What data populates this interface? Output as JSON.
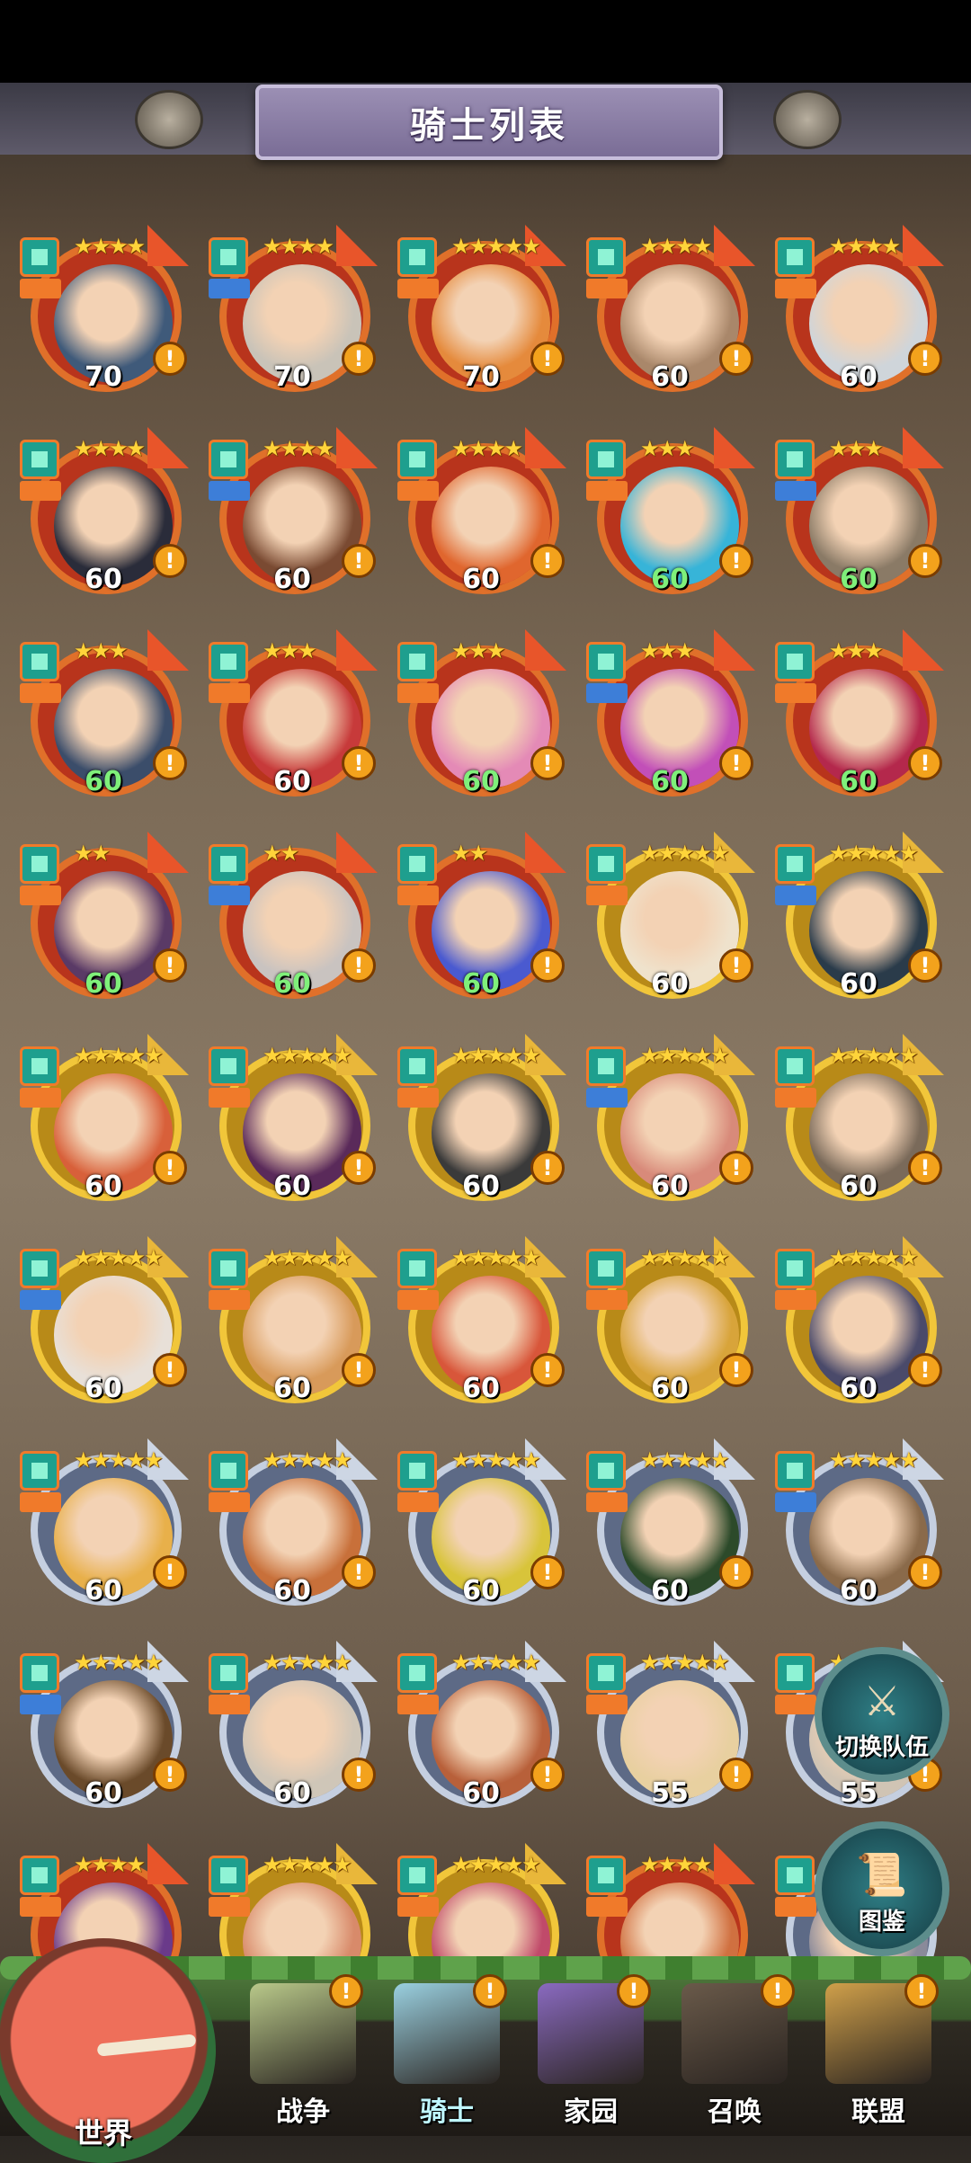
{
  "header": {
    "title": "骑士列表"
  },
  "knights": [
    {
      "level": "70",
      "stars": "★★★★",
      "frame": "red",
      "role": "orange",
      "green": false
    },
    {
      "level": "70",
      "stars": "★★★★",
      "frame": "red",
      "role": "blue",
      "green": false
    },
    {
      "level": "70",
      "stars": "★★★★★",
      "frame": "red",
      "role": "orange",
      "green": false
    },
    {
      "level": "60",
      "stars": "★★★★",
      "frame": "red",
      "role": "orange",
      "green": false
    },
    {
      "level": "60",
      "stars": "★★★★",
      "frame": "red",
      "role": "orange",
      "green": false
    },
    {
      "level": "60",
      "stars": "★★★★",
      "frame": "red",
      "role": "orange",
      "green": false
    },
    {
      "level": "60",
      "stars": "★★★★",
      "frame": "red",
      "role": "blue",
      "green": false
    },
    {
      "level": "60",
      "stars": "★★★★",
      "frame": "red",
      "role": "orange",
      "green": false
    },
    {
      "level": "60",
      "stars": "★★★",
      "frame": "red",
      "role": "orange",
      "green": true
    },
    {
      "level": "60",
      "stars": "★★★",
      "frame": "red",
      "role": "blue",
      "green": true
    },
    {
      "level": "60",
      "stars": "★★★",
      "frame": "red",
      "role": "orange",
      "green": true
    },
    {
      "level": "60",
      "stars": "★★★",
      "frame": "red",
      "role": "orange",
      "green": false
    },
    {
      "level": "60",
      "stars": "★★★",
      "frame": "red",
      "role": "orange",
      "green": true
    },
    {
      "level": "60",
      "stars": "★★★",
      "frame": "red",
      "role": "blue",
      "green": true
    },
    {
      "level": "60",
      "stars": "★★★",
      "frame": "red",
      "role": "orange",
      "green": true
    },
    {
      "level": "60",
      "stars": "★★",
      "frame": "red",
      "role": "orange",
      "green": true
    },
    {
      "level": "60",
      "stars": "★★",
      "frame": "red",
      "role": "blue",
      "green": true
    },
    {
      "level": "60",
      "stars": "★★",
      "frame": "red",
      "role": "orange",
      "green": true
    },
    {
      "level": "60",
      "stars": "★★★★★",
      "frame": "gold",
      "role": "orange",
      "green": false
    },
    {
      "level": "60",
      "stars": "★★★★★",
      "frame": "gold",
      "role": "blue",
      "green": false
    },
    {
      "level": "60",
      "stars": "★★★★★",
      "frame": "gold",
      "role": "orange",
      "green": false
    },
    {
      "level": "60",
      "stars": "★★★★★",
      "frame": "gold",
      "role": "orange",
      "green": false
    },
    {
      "level": "60",
      "stars": "★★★★★",
      "frame": "gold",
      "role": "orange",
      "green": false
    },
    {
      "level": "60",
      "stars": "★★★★★",
      "frame": "gold",
      "role": "blue",
      "green": false
    },
    {
      "level": "60",
      "stars": "★★★★★",
      "frame": "gold",
      "role": "orange",
      "green": false
    },
    {
      "level": "60",
      "stars": "★★★★★",
      "frame": "gold",
      "role": "blue",
      "green": false
    },
    {
      "level": "60",
      "stars": "★★★★★",
      "frame": "gold",
      "role": "orange",
      "green": false
    },
    {
      "level": "60",
      "stars": "★★★★★",
      "frame": "gold",
      "role": "orange",
      "green": false
    },
    {
      "level": "60",
      "stars": "★★★★★",
      "frame": "gold",
      "role": "orange",
      "green": false
    },
    {
      "level": "60",
      "stars": "★★★★★",
      "frame": "gold",
      "role": "orange",
      "green": false
    },
    {
      "level": "60",
      "stars": "★★★★★",
      "frame": "silver",
      "role": "orange",
      "green": false
    },
    {
      "level": "60",
      "stars": "★★★★★",
      "frame": "silver",
      "role": "orange",
      "green": false
    },
    {
      "level": "60",
      "stars": "★★★★★",
      "frame": "silver",
      "role": "orange",
      "green": false
    },
    {
      "level": "60",
      "stars": "★★★★★",
      "frame": "silver",
      "role": "orange",
      "green": false
    },
    {
      "level": "60",
      "stars": "★★★★★",
      "frame": "silver",
      "role": "blue",
      "green": false
    },
    {
      "level": "60",
      "stars": "★★★★★",
      "frame": "silver",
      "role": "blue",
      "green": false
    },
    {
      "level": "60",
      "stars": "★★★★★",
      "frame": "silver",
      "role": "orange",
      "green": false
    },
    {
      "level": "60",
      "stars": "★★★★★",
      "frame": "silver",
      "role": "orange",
      "green": false
    },
    {
      "level": "55",
      "stars": "★★★★★",
      "frame": "silver",
      "role": "orange",
      "green": false
    },
    {
      "level": "55",
      "stars": "★★★★★",
      "frame": "silver",
      "role": "orange",
      "green": false
    },
    {
      "level": "",
      "stars": "★★★★",
      "frame": "red",
      "role": "orange",
      "green": false
    },
    {
      "level": "",
      "stars": "★★★★★",
      "frame": "gold",
      "role": "orange",
      "green": false
    },
    {
      "level": "",
      "stars": "★★★★★",
      "frame": "gold",
      "role": "orange",
      "green": false
    },
    {
      "level": "",
      "stars": "★★★★",
      "frame": "red",
      "role": "orange",
      "green": false
    },
    {
      "level": "",
      "stars": "★★★★★",
      "frame": "silver",
      "role": "orange",
      "green": false
    }
  ],
  "portrait_colors": [
    "#3f5a7a",
    "#c9c3b8",
    "#e58a3c",
    "#a9876a",
    "#cfd5da",
    "#2a2c3a",
    "#7a4a32",
    "#e0662e",
    "#37b4d8",
    "#8a7a66",
    "#3b4d6a",
    "#c73a3a",
    "#e48ab6",
    "#c24fb8",
    "#b4284c",
    "#5a3a66",
    "#c9c3c0",
    "#4a5ad0",
    "#efe2cc",
    "#2a3b4a",
    "#d8603a",
    "#5a2a5a",
    "#3a3a3a",
    "#d88a7a",
    "#7a6a5a",
    "#e8e0d8",
    "#d89a5a",
    "#d8563a",
    "#d8a43a",
    "#4a4a6a",
    "#e8b04a",
    "#c8703a",
    "#d8c43a",
    "#2c4a2a",
    "#8a6a4a",
    "#6a4a2a",
    "#cfc6b8",
    "#b8603a",
    "#e8d0a0",
    "#d0c4b4",
    "#6a3a8a",
    "#d88a6a",
    "#c04a6a",
    "#d07040",
    "#8a8a9a"
  ],
  "alert_symbol": "!",
  "side_buttons": [
    {
      "label": "切换队伍",
      "icon": "shield-sword-icon"
    },
    {
      "label": "图鉴",
      "icon": "book-icon"
    }
  ],
  "nav": {
    "world": "世界",
    "items": [
      {
        "label": "战争",
        "icon": "map-icon",
        "color": "#b9c98a"
      },
      {
        "label": "骑士",
        "icon": "wizard-icon",
        "color": "#9ad0e0"
      },
      {
        "label": "家园",
        "icon": "house-icon",
        "color": "#8a6ac0"
      },
      {
        "label": "召唤",
        "icon": "train-icon",
        "color": "#6a5a4a"
      },
      {
        "label": "联盟",
        "icon": "helmet-icon",
        "color": "#d0a04a"
      }
    ]
  }
}
